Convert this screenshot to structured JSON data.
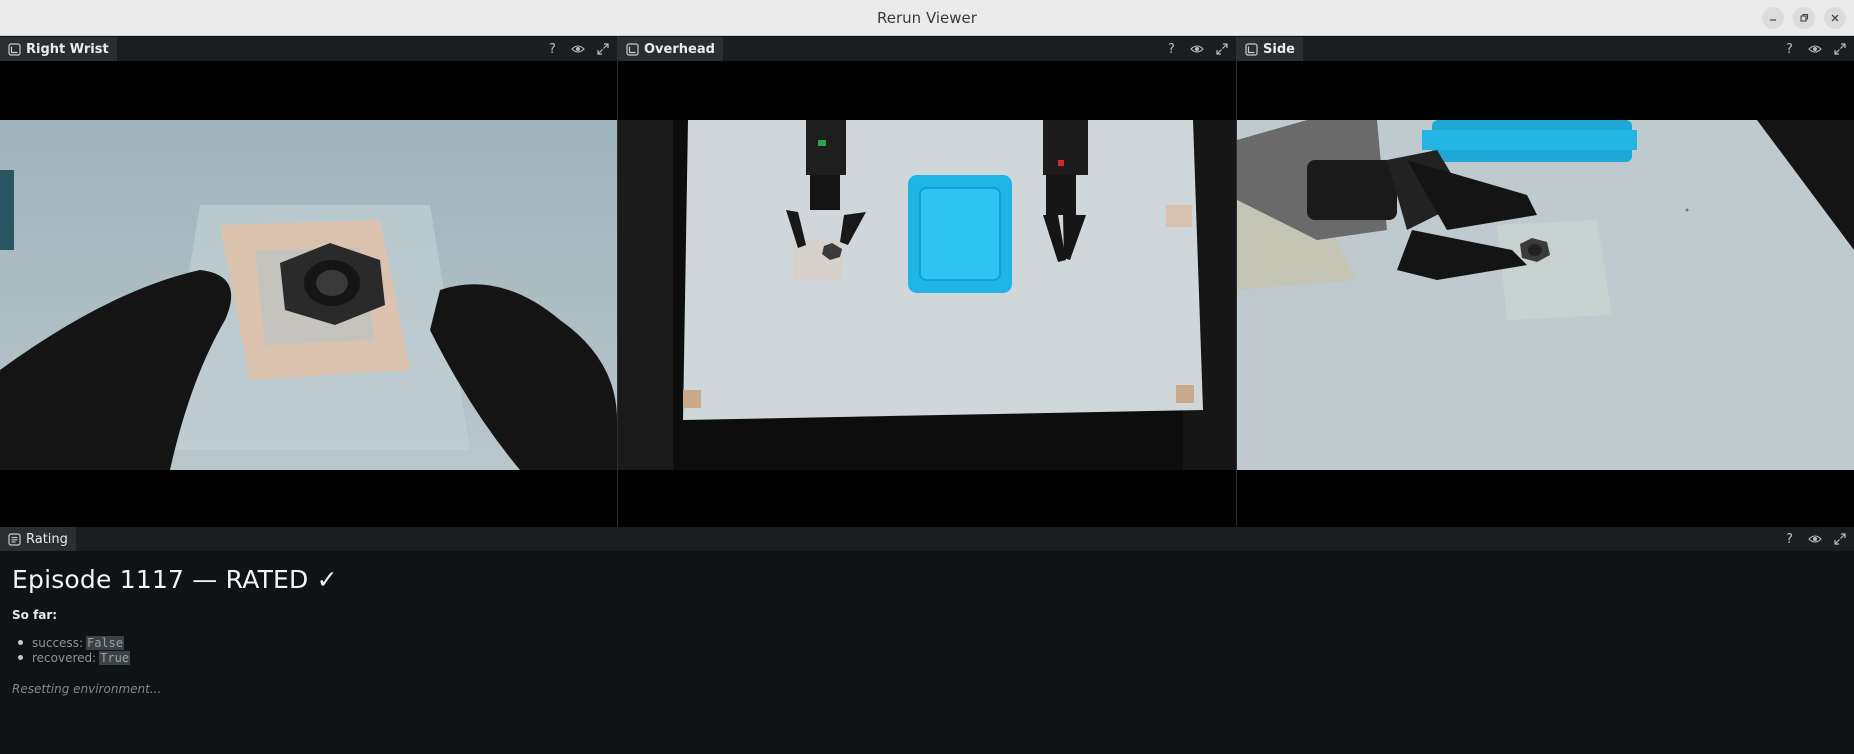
{
  "window": {
    "title": "Rerun Viewer",
    "controls": [
      "minimize-icon",
      "restore-icon",
      "close-icon"
    ]
  },
  "panels": [
    {
      "name": "Right Wrist",
      "icon": "view-2d-icon",
      "actions": [
        "help-icon",
        "eye-icon",
        "expand-icon"
      ]
    },
    {
      "name": "Overhead",
      "icon": "view-2d-icon",
      "actions": [
        "help-icon",
        "eye-icon",
        "expand-icon"
      ]
    },
    {
      "name": "Side",
      "icon": "view-2d-icon",
      "actions": [
        "help-icon",
        "eye-icon",
        "expand-icon"
      ]
    }
  ],
  "rating": {
    "tab_label": "Rating",
    "icon": "text-doc-icon",
    "heading": "Episode 1117 — RATED ✓",
    "so_far_label": "So far:",
    "items": [
      {
        "key": "success:",
        "value": "False"
      },
      {
        "key": "recovered:",
        "value": "True"
      }
    ],
    "status": "Resetting environment..."
  },
  "colors": {
    "titlebar_bg": "#ebebeb",
    "panel_bg": "#000000",
    "rating_bg": "#0f1315",
    "tray_blue": "#1fb6e6"
  }
}
